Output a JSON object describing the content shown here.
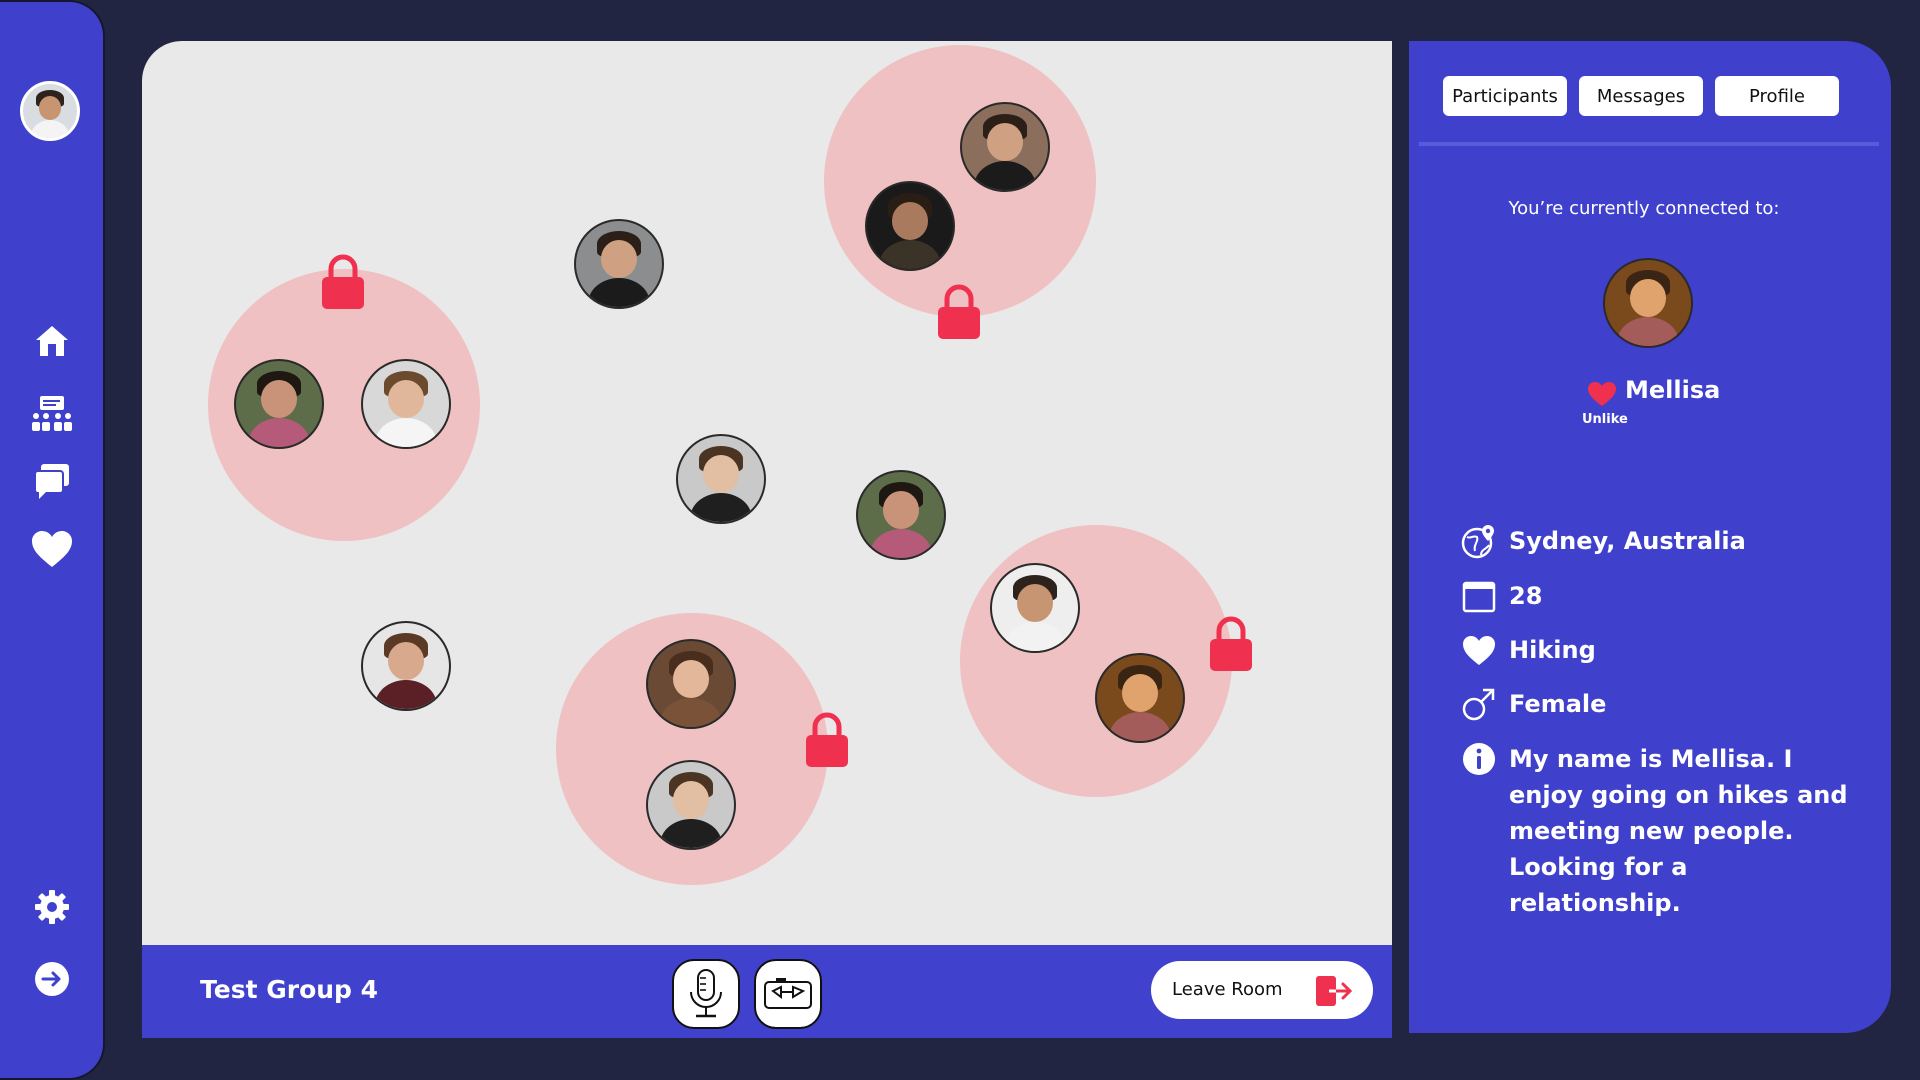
{
  "sidebar": {
    "items": [
      {
        "name": "user-avatar"
      },
      {
        "icon": "home-icon"
      },
      {
        "icon": "rooms-icon"
      },
      {
        "icon": "chat-icon"
      },
      {
        "icon": "heart-icon"
      },
      {
        "icon": "gear-icon"
      },
      {
        "icon": "logout-icon"
      }
    ]
  },
  "room": {
    "name": "Test Group 4",
    "leave_label": "Leave Room"
  },
  "tabs": [
    "Participants",
    "Messages",
    "Profile"
  ],
  "profile": {
    "connected_label": "You’re currently connected to:",
    "name": "Mellisa",
    "unlike_label": "Unlike",
    "location": "Sydney, Australia",
    "age": "28",
    "interest": "Hiking",
    "gender": "Female",
    "bio": "My name is Mellisa. I enjoy going on hikes and meeting new people. Looking for a relationship."
  },
  "colors": {
    "background": "#212542",
    "primary": "#3f40cc",
    "stage": "#e9e9e9",
    "bubble": "#f0c1c3",
    "lock": "#f0304f"
  }
}
